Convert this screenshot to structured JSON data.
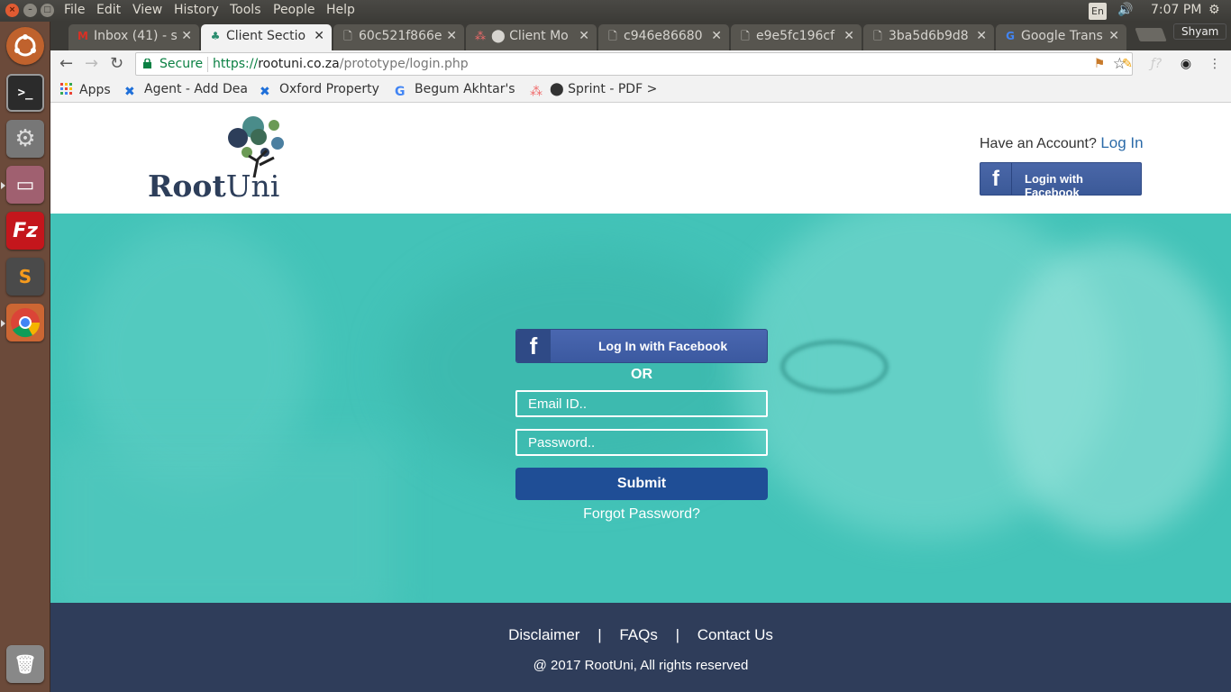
{
  "os": {
    "menus": [
      "File",
      "Edit",
      "View",
      "History",
      "Tools",
      "People",
      "Help"
    ],
    "language": "En",
    "clock": "7:07 PM"
  },
  "browser": {
    "profile": "Shyam",
    "tabs": [
      {
        "label": "Inbox (41) - s",
        "icon": "gmail-icon",
        "active": false
      },
      {
        "label": "Client Sectio",
        "icon": "asana-icon",
        "active": true
      },
      {
        "label": "60c521f866e",
        "icon": "document-icon",
        "active": false
      },
      {
        "label": "⬤ Client Mo",
        "icon": "asana-icon",
        "active": false
      },
      {
        "label": "c946e86680",
        "icon": "document-icon",
        "active": false
      },
      {
        "label": "e9e5fc196cf",
        "icon": "document-icon",
        "active": false
      },
      {
        "label": "3ba5d6b9d8",
        "icon": "document-icon",
        "active": false
      },
      {
        "label": "Google Trans",
        "icon": "google-translate-icon",
        "active": false
      }
    ],
    "secure_label": "Secure",
    "url_scheme": "https://",
    "url_host": "rootuni.co.za",
    "url_path": "/prototype/login.php",
    "bookmarks": [
      {
        "label": "Apps",
        "icon": "apps-grid-icon"
      },
      {
        "label": "Agent - Add Dea",
        "icon": "x-logo-icon"
      },
      {
        "label": "Oxford Property",
        "icon": "x-logo-icon"
      },
      {
        "label": "Begum Akhtar's",
        "icon": "google-icon"
      },
      {
        "label": "⬤ Sprint - PDF >",
        "icon": "asana-icon"
      }
    ]
  },
  "site": {
    "logo_root": "Root",
    "logo_uni": "Uni",
    "have_account": "Have an Account?",
    "log_in_link": "Log In",
    "header_fb_button": "Login with Facebook",
    "fb_glyph": "f",
    "main_fb_button": "Log In with Facebook",
    "or_label": "OR",
    "email_placeholder": "Email ID..",
    "password_placeholder": "Password..",
    "submit_label": "Submit",
    "forgot_password": "Forgot Password?",
    "footer": {
      "links": [
        "Disclaimer",
        "FAQs",
        "Contact Us"
      ],
      "separator": "|",
      "copyright": "@ 2017 RootUni, All rights reserved"
    }
  },
  "colors": {
    "hero_teal": "#43c3b8",
    "footer_navy": "#2f3d5a",
    "facebook_blue": "#3b5998",
    "submit_blue": "#1f4e96",
    "link_blue": "#2a6aa8"
  }
}
